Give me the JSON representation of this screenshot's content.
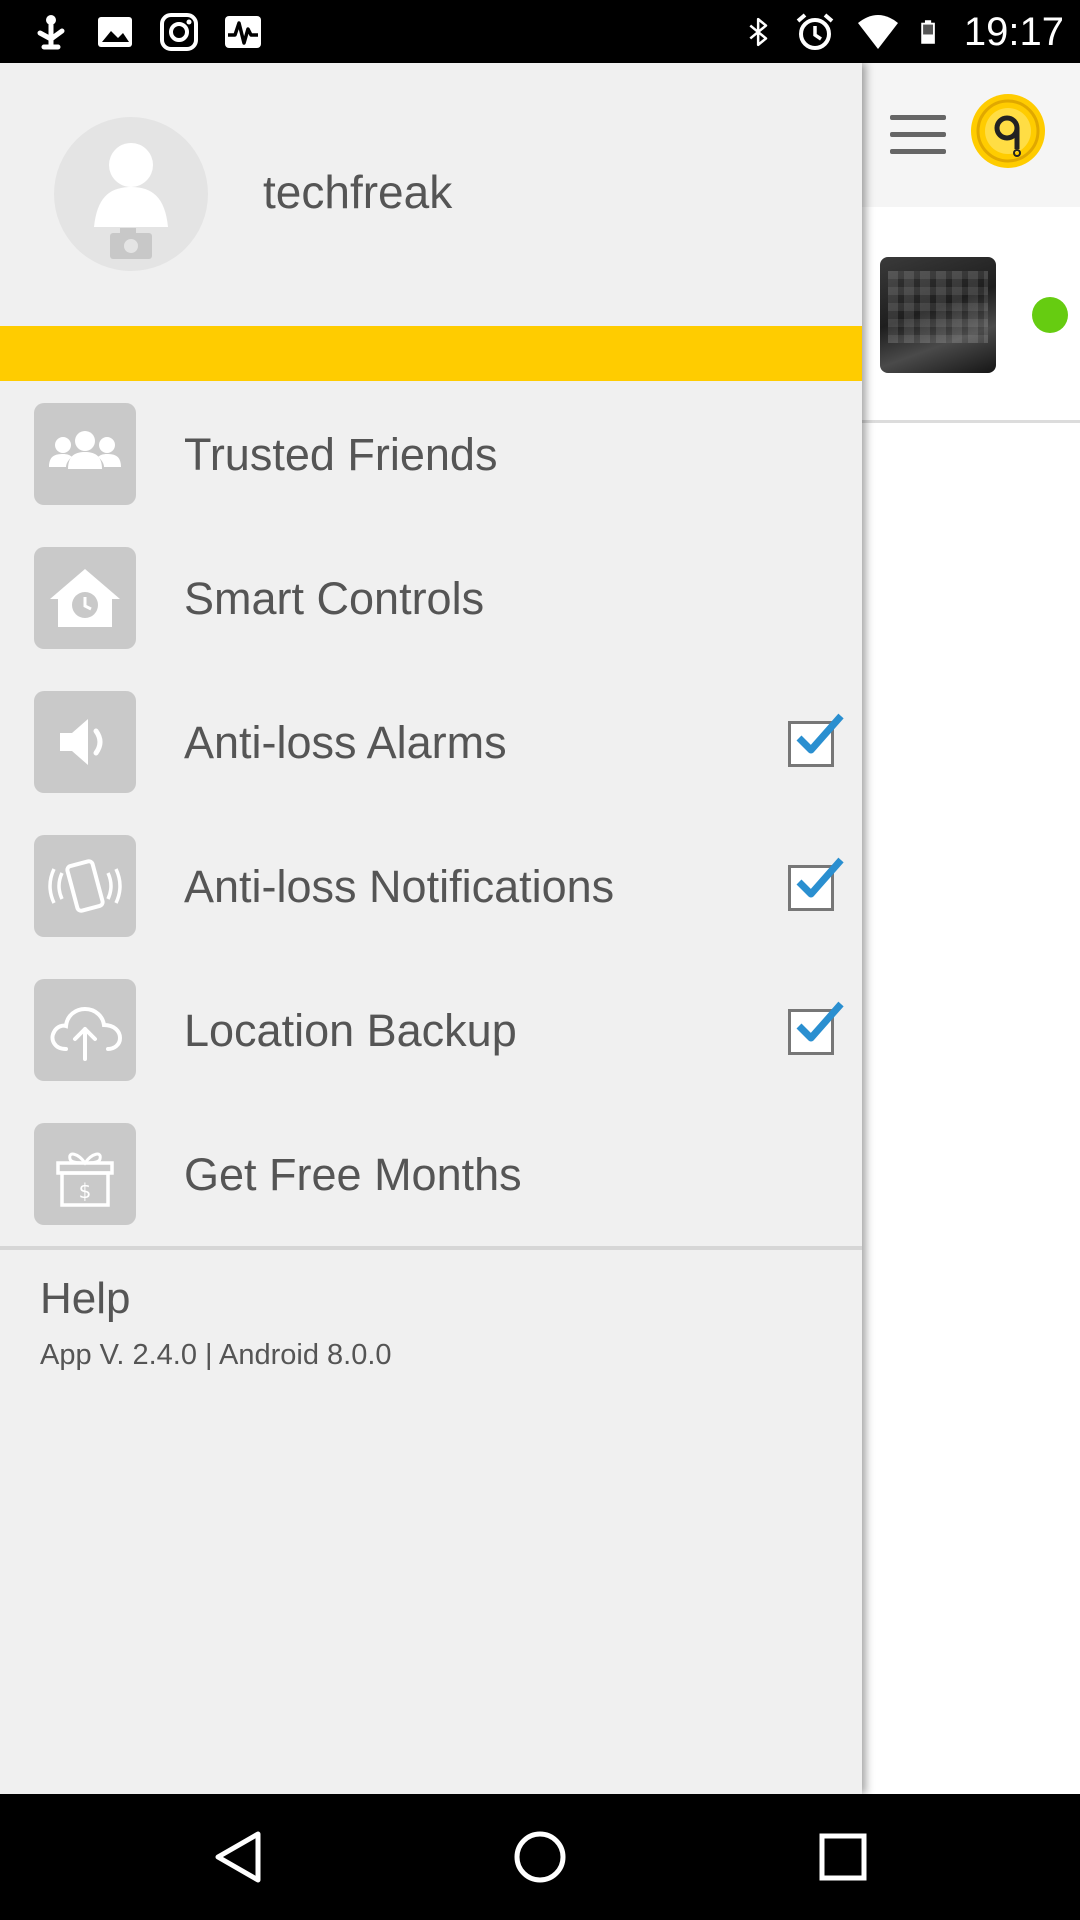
{
  "status_bar": {
    "time": "19:17",
    "left_icons": [
      "usb-debug-icon",
      "image-icon",
      "instagram-icon",
      "pulse-app-icon"
    ],
    "right_icons": [
      "bluetooth-icon",
      "alarm-clock-icon",
      "wifi-icon",
      "battery-icon"
    ]
  },
  "drawer": {
    "username": "techfreak",
    "accent_color": "#ffcc00",
    "menu": [
      {
        "label": "Trusted Friends",
        "icon": "group-icon"
      },
      {
        "label": "Smart Controls",
        "icon": "home-clock-icon"
      },
      {
        "label": "Anti-loss Alarms",
        "icon": "speaker-icon",
        "checked": true
      },
      {
        "label": "Anti-loss Notifications",
        "icon": "phone-vibrate-icon",
        "checked": true
      },
      {
        "label": "Location Backup",
        "icon": "cloud-upload-icon",
        "checked": true
      },
      {
        "label": "Get Free Months",
        "icon": "gift-icon"
      }
    ],
    "help": "Help",
    "version": "App V. 2.4.0 | Android 8.0.0"
  },
  "main": {
    "online_status_color": "#66cc11"
  },
  "nav_bar": {
    "buttons": [
      "back-icon",
      "home-icon",
      "recents-icon"
    ]
  }
}
